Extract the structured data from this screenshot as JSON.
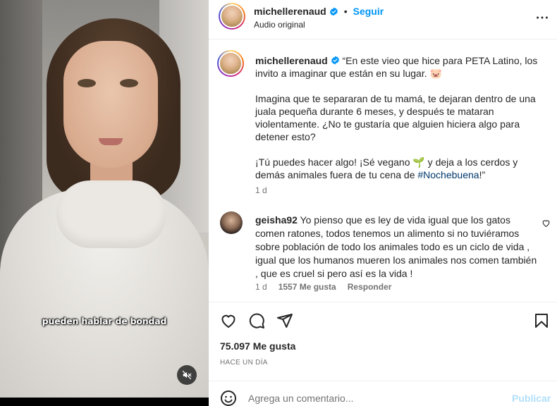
{
  "video": {
    "caption": "pueden hablar de bondad",
    "mute_icon": "speaker-muted-icon"
  },
  "post": {
    "username": "michellerenaud",
    "follow_label": "Seguir",
    "separator": "•",
    "audio_label": "Audio original",
    "more_icon": "more-options-icon",
    "verified_color": "#0095f6"
  },
  "caption": {
    "username": "michellerenaud",
    "paragraph1": "“En este vieo que hice para PETA Latino, los invito a imaginar que están en su lugar. 🐷",
    "paragraph2": "Imagina que te separaran de tu mamá, te dejaran dentro de una juala pequeña durante 6 meses, y después te mataran violentamente. ¿No te gustaría que alguien hiciera algo para detener esto?",
    "paragraph3_before": "¡Tú puedes hacer algo! ¡Sé vegano 🌱 y deja a los cerdos y demás animales fuera de tu cena de ",
    "hashtag": "#Nochebuena",
    "paragraph3_after": "!”",
    "time": "1 d"
  },
  "comment": {
    "username": "geisha92",
    "text": "Yo pienso que es ley de vida igual que los gatos comen ratones, todos tenemos un alimento si no tuviéramos sobre población de todo los animales todo es un ciclo de vida , igual que los humanos mueren los animales nos comen también , que es cruel si pero así es la vida !",
    "time": "1 d",
    "likes": "1557 Me gusta",
    "reply": "Responder"
  },
  "actions": {
    "likes": "75.097 Me gusta",
    "timestamp": "HACE UN DÍA"
  },
  "add_comment": {
    "placeholder": "Agrega un comentario...",
    "publish_label": "Publicar"
  },
  "colors": {
    "link": "#0095f6",
    "hashtag": "#00376b",
    "muted_text": "#737373",
    "publish_disabled": "#b2dffc"
  }
}
